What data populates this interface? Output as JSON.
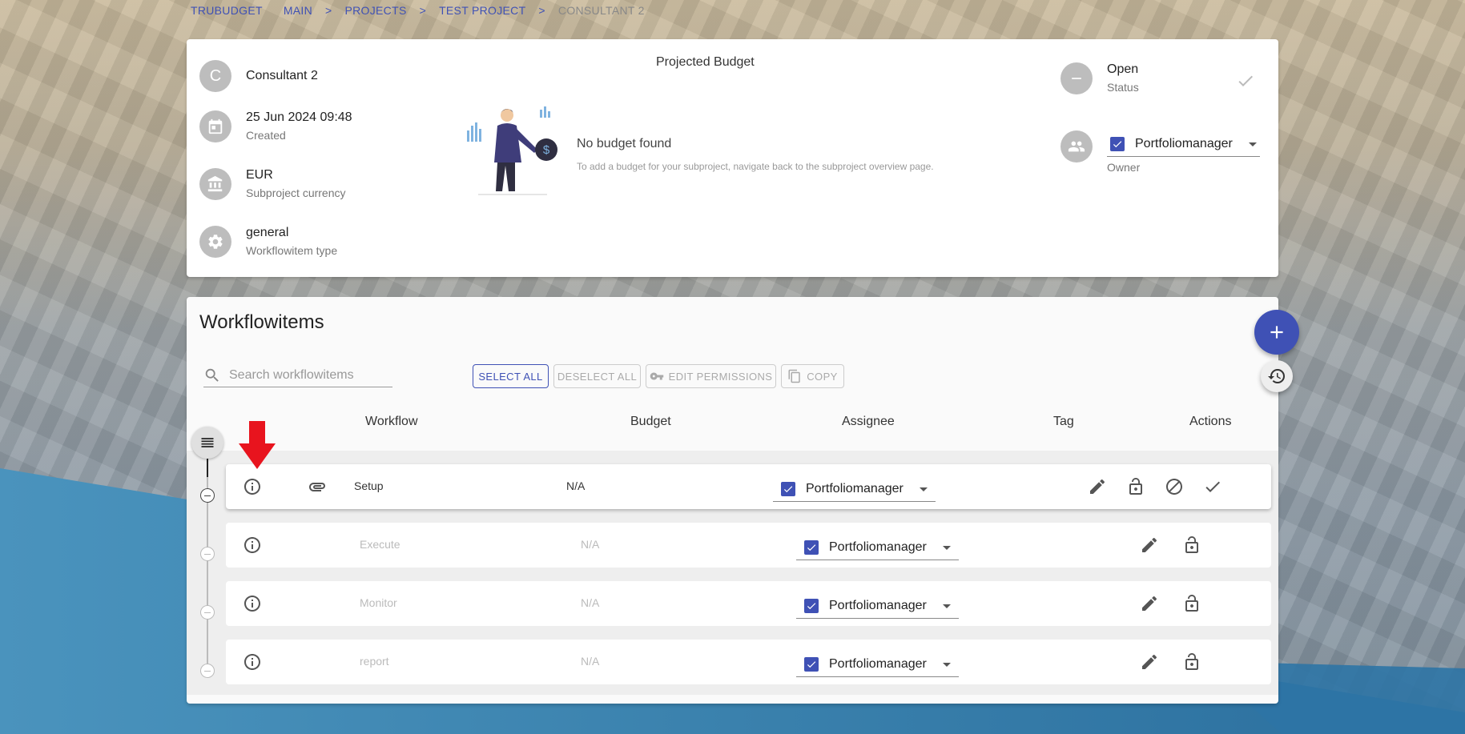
{
  "breadcrumb": {
    "items": [
      "TRUBUDGET",
      "MAIN",
      "PROJECTS",
      "TEST PROJECT",
      "CONSULTANT 2"
    ]
  },
  "details": {
    "avatar_letter": "C",
    "name": "Consultant 2",
    "created_value": "25 Jun 2024 09:48",
    "created_label": "Created",
    "currency_value": "EUR",
    "currency_label": "Subproject currency",
    "type_value": "general",
    "type_label": "Workflowitem type"
  },
  "budget": {
    "title": "Projected Budget",
    "empty_title": "No budget found",
    "empty_desc": "To add a budget for your subproject, navigate back to the subproject overview page."
  },
  "status": {
    "value": "Open",
    "label": "Status"
  },
  "owner": {
    "value": "Portfoliomanager",
    "label": "Owner"
  },
  "workflow": {
    "title": "Workflowitems",
    "search_placeholder": "Search workflowitems",
    "buttons": {
      "select_all": "SELECT ALL",
      "deselect_all": "DESELECT ALL",
      "edit_permissions": "EDIT PERMISSIONS",
      "copy": "COPY"
    },
    "columns": [
      "Workflow",
      "Budget",
      "Assignee",
      "Tag",
      "Actions"
    ],
    "rows": [
      {
        "name": "Setup",
        "budget": "N/A",
        "assignee": "Portfoliomanager"
      },
      {
        "name": "Execute",
        "budget": "N/A",
        "assignee": "Portfoliomanager"
      },
      {
        "name": "Monitor",
        "budget": "N/A",
        "assignee": "Portfoliomanager"
      },
      {
        "name": "report",
        "budget": "N/A",
        "assignee": "Portfoliomanager"
      }
    ]
  },
  "colors": {
    "primary": "#3f51b5",
    "annotation_arrow": "#e8141e",
    "wave": "#3d86b0"
  }
}
